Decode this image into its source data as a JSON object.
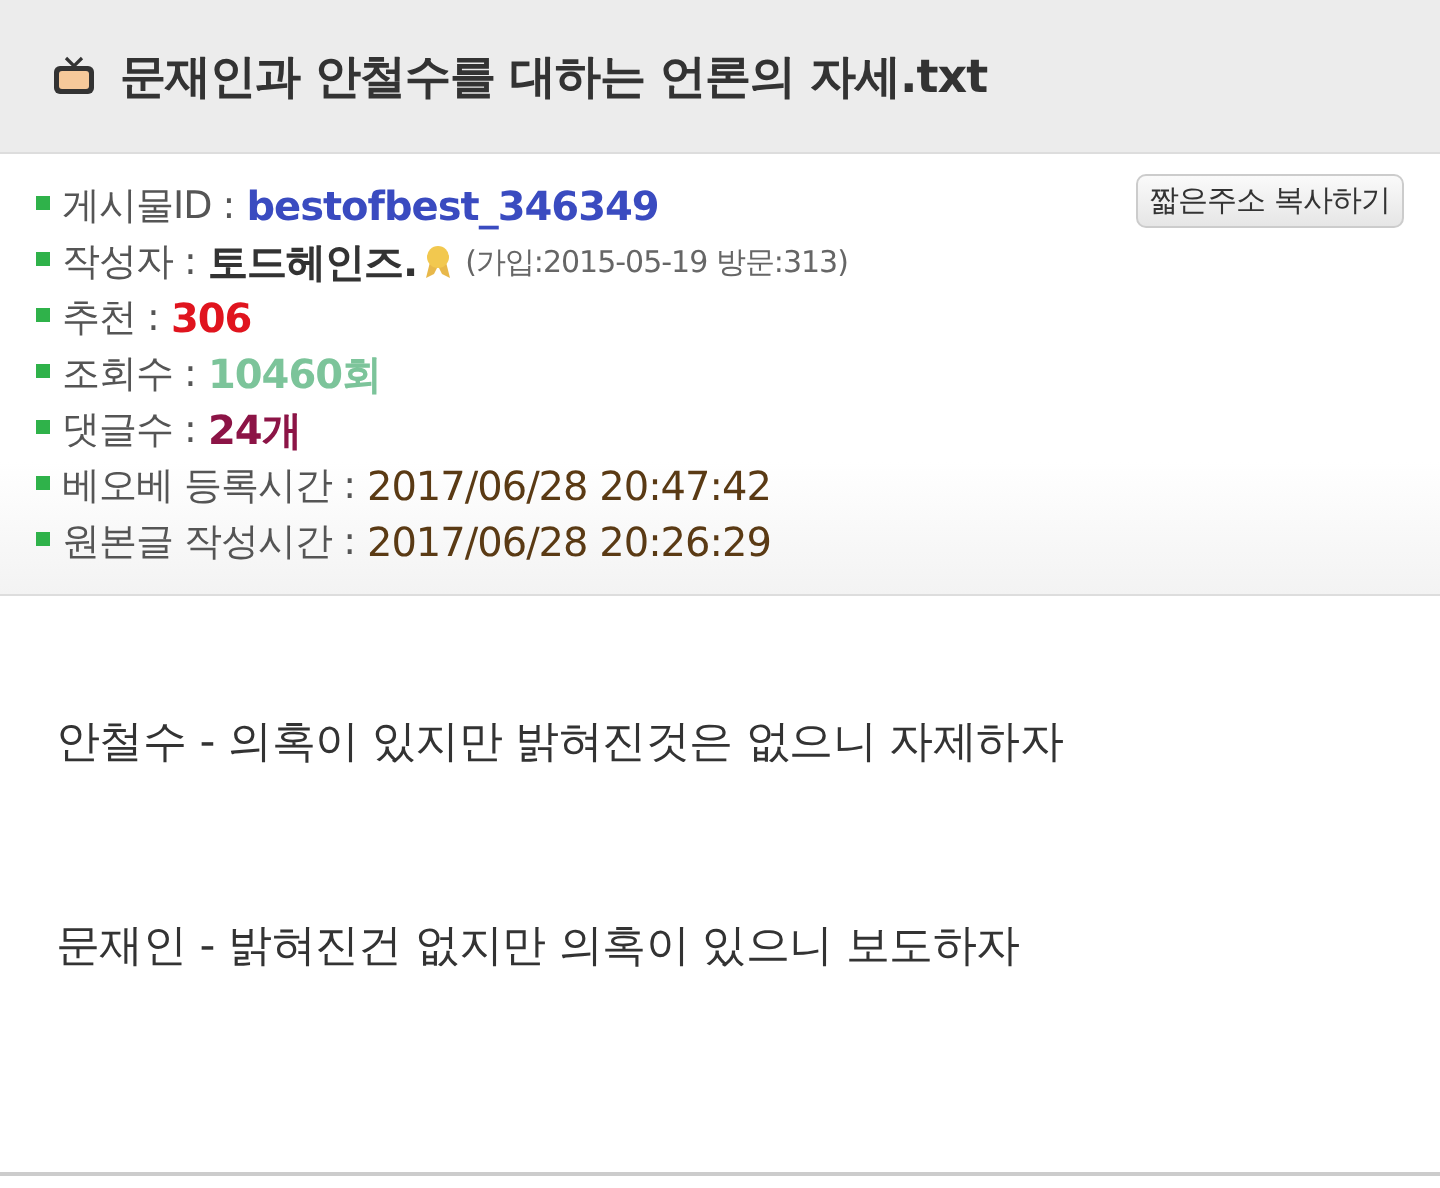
{
  "title": "문재인과 안철수를 대하는 언론의 자세.txt",
  "copy_button": "짧은주소 복사하기",
  "info": [
    {
      "kind": "emphasis",
      "label": "게시물ID :",
      "value": "bestofbest_346349",
      "color": "#3a4bc0"
    },
    {
      "kind": "author",
      "label": "작성자 :",
      "value": "토드헤인즈.",
      "meta": "(가입:2015-05-19 방문:313)",
      "color": "#333333"
    },
    {
      "kind": "emphasis",
      "label": "추천 :",
      "value": "306",
      "color": "#e0141e"
    },
    {
      "kind": "emphasis",
      "label": "조회수 :",
      "value": "10460회",
      "color": "#7cc49a"
    },
    {
      "kind": "emphasis",
      "label": "댓글수 :",
      "value": "24개",
      "color": "#8c1446"
    },
    {
      "kind": "date",
      "label": "베오베 등록시간 :",
      "value": "2017/06/28 20:47:42",
      "color": "#5a3a14"
    },
    {
      "kind": "date",
      "label": "원본글 작성시간 :",
      "value": "2017/06/28 20:26:29",
      "color": "#5a3a14"
    }
  ],
  "body": [
    "안철수 - 의혹이 있지만 밝혀진것은 없으니 자제하자",
    "문재인 - 밝혀진건 없지만 의혹이 있으니 보도하자"
  ]
}
